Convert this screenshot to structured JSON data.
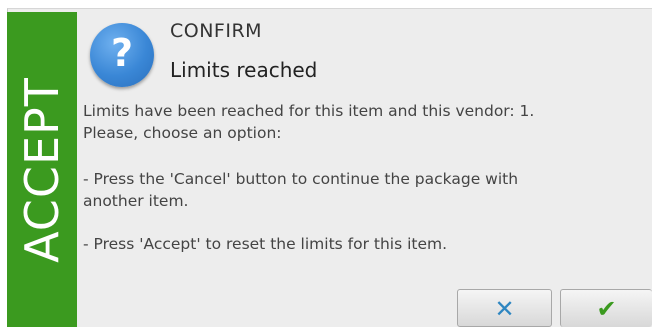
{
  "accept_bar": {
    "label": "ACCEPT",
    "color": "#3b9a1f"
  },
  "dialog": {
    "icon": "question-icon",
    "icon_glyph": "?",
    "title": "CONFIRM",
    "subtitle": "Limits reached",
    "message_lines": [
      "Limits have been reached for this item and this vendor: 1.",
      "Please, choose an option:",
      "- Press the 'Cancel' button to continue the package with",
      "another item.",
      "- Press 'Accept' to reset the limits for this item."
    ]
  },
  "buttons": {
    "cancel": {
      "icon": "close-icon",
      "glyph": "✕",
      "color": "#2e86c1"
    },
    "accept": {
      "icon": "check-icon",
      "glyph": "✔",
      "color": "#3b9a1f"
    }
  }
}
